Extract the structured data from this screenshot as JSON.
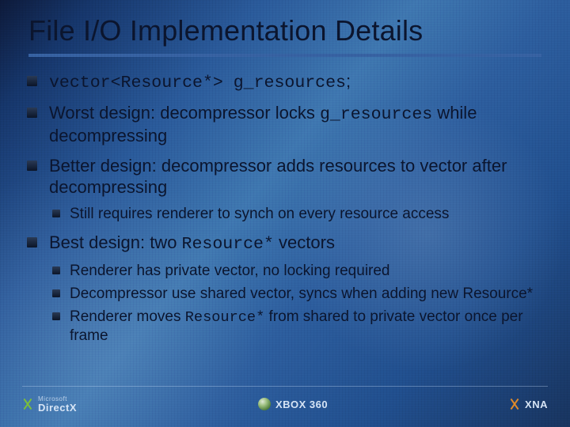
{
  "title": "File I/O Implementation Details",
  "bullets": {
    "b1_code": "vector<Resource*> g_resources",
    "b1_tail": ";",
    "b2_pre": "Worst design: decompressor locks ",
    "b2_code": "g_resources",
    "b2_post": " while decompressing",
    "b3": "Better design: decompressor adds resources to vector after decompressing",
    "b3_sub1": "Still requires renderer to synch on every resource access",
    "b4_pre": "Best design: two ",
    "b4_code": "Resource*",
    "b4_post": " vectors",
    "b4_sub1": "Renderer has private vector, no locking required",
    "b4_sub2": "Decompressor use shared vector, syncs when adding new Resource*",
    "b4_sub3_pre": "Renderer moves ",
    "b4_sub3_code": "Resource*",
    "b4_sub3_post": " from shared to private vector once per frame"
  },
  "footer": {
    "left_small": "Microsoft",
    "left_brand": "DirectX",
    "center_brand": "XBOX 360",
    "right_brand": "XNA"
  }
}
